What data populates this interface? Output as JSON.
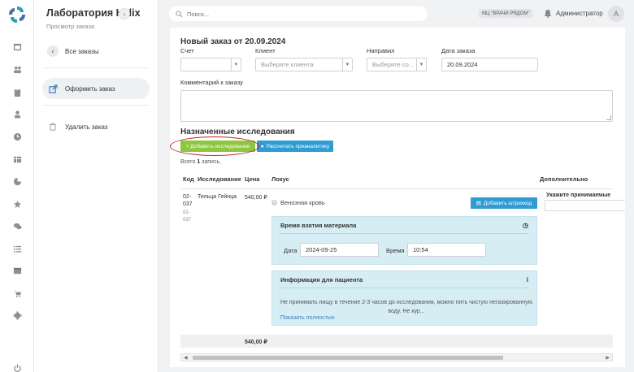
{
  "app": {
    "title": "Лаборатория Helix",
    "subtitle": "Просмотр заказа"
  },
  "sidebar": {
    "back_label": "Все заказы",
    "create_label": "Оформить заказ",
    "delete_label": "Удалить заказ"
  },
  "rail_icons": [
    "calendar-icon",
    "users-icon",
    "clipboard-icon",
    "user-icon",
    "clock-icon",
    "table-icon",
    "pie-chart-icon",
    "star-icon",
    "chat-icon",
    "list-icon",
    "box-icon",
    "cart-icon",
    "gear-icon",
    "power-icon"
  ],
  "topbar": {
    "search_placeholder": "Поиск...",
    "org_label": "МЦ \"ВРАЧИ РЯДОМ\"",
    "user_name": "Администратор",
    "avatar_letter": "А"
  },
  "order": {
    "title": "Новый заказ от 20.09.2024",
    "account_label": "Счет",
    "account_value": "",
    "client_label": "Клиент",
    "client_placeholder": "Выберите клиента",
    "referrer_label": "Направил",
    "referrer_placeholder": "Выберите со...",
    "date_label": "Дата заказа",
    "date_value": "20.09.2024",
    "comment_label": "Комментарий к заказу",
    "comment_value": ""
  },
  "studies": {
    "title": "Назначенные исследования",
    "add_button": "+ Добавить исследование",
    "calc_button": "Рассчитать преаналитику",
    "records_prefix": "Всего ",
    "records_count": "1",
    "records_suffix": " запись.",
    "columns": {
      "code": "Код",
      "study": "Исследование",
      "price": "Цена",
      "locus": "Локус",
      "extra": "Дополнительно"
    },
    "row": {
      "code_line1": "02-",
      "code_line2": "037",
      "code_sub1": "02-",
      "code_sub2": "037",
      "study": "Тельца Гейнца",
      "price": "540,00 ₽",
      "locus": "Венозная кровь",
      "barcode_button": "Добавить штрихкод",
      "extra_text": "Укажите принимаемые"
    },
    "sampling": {
      "title": "Время взятия материала",
      "date_label": "Дата",
      "date_value": "2024-09-25",
      "time_label": "Время",
      "time_value": "10:54"
    },
    "patient_info": {
      "title": "Информация для пациента",
      "text": "Не принимать пищу в течение 2-3 часов до исследования, можно пить чистую негазированную воду. Не кур...",
      "link": "Показать полностью"
    },
    "total": "540,00 ₽"
  },
  "colors": {
    "green": "#8dc63f",
    "blue": "#2f9cd4",
    "panel": "#d6edf3",
    "annotation": "#c0272d"
  }
}
